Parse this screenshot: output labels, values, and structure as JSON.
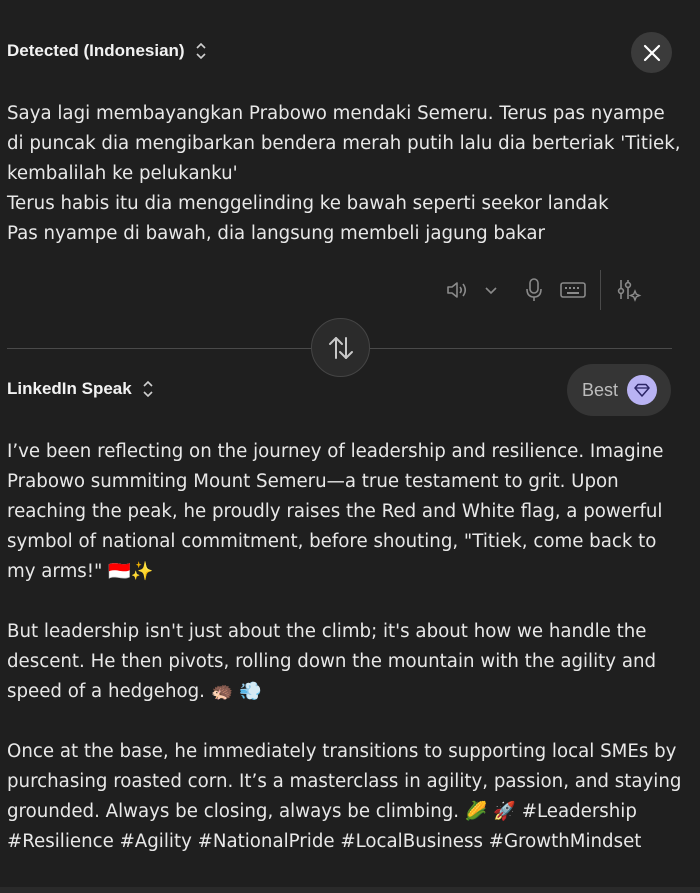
{
  "source": {
    "language_label": "Detected (Indonesian)",
    "text": "Saya lagi membayangkan Prabowo mendaki Semeru. Terus pas nyampe di puncak dia mengibarkan bendera merah putih lalu dia berteriak 'Titiek, kembalilah ke pelukanku'\nTerus habis itu dia menggelinding ke bawah seperti seekor landak\nPas nyampe di bawah, dia langsung membeli jagung bakar"
  },
  "toolbar": {
    "icons": [
      "speaker-icon",
      "chevron-down-icon",
      "microphone-icon",
      "keyboard-icon",
      "sliders-sparkle-icon"
    ]
  },
  "target": {
    "style_label": "LinkedIn Speak",
    "best_label": "Best",
    "paragraphs": [
      "I’ve been reflecting on the journey of leadership and resilience. Imagine Prabowo summiting Mount Semeru—a true testament to grit. Upon reaching the peak, he proudly raises the Red and White flag, a powerful symbol of national commitment, before shouting, \"Titiek, come back to my arms!\" 🇮🇩✨",
      "But leadership isn't just about the climb; it's about how we handle the descent. He then pivots, rolling down the mountain with the agility and speed of a hedgehog. 🦔 💨",
      "Once at the base, he immediately transitions to supporting local SMEs by purchasing roasted corn. It’s a masterclass in agility, passion, and staying grounded. Always be closing, always be climbing. 🌽 🚀 #Leadership #Resilience #Agility #NationalPride #LocalBusiness #GrowthMindset"
    ]
  },
  "colors": {
    "background": "#1f1f1f",
    "text": "#e8e8e8",
    "badge": "#b9b3f3",
    "divider": "#4a4a4a"
  }
}
